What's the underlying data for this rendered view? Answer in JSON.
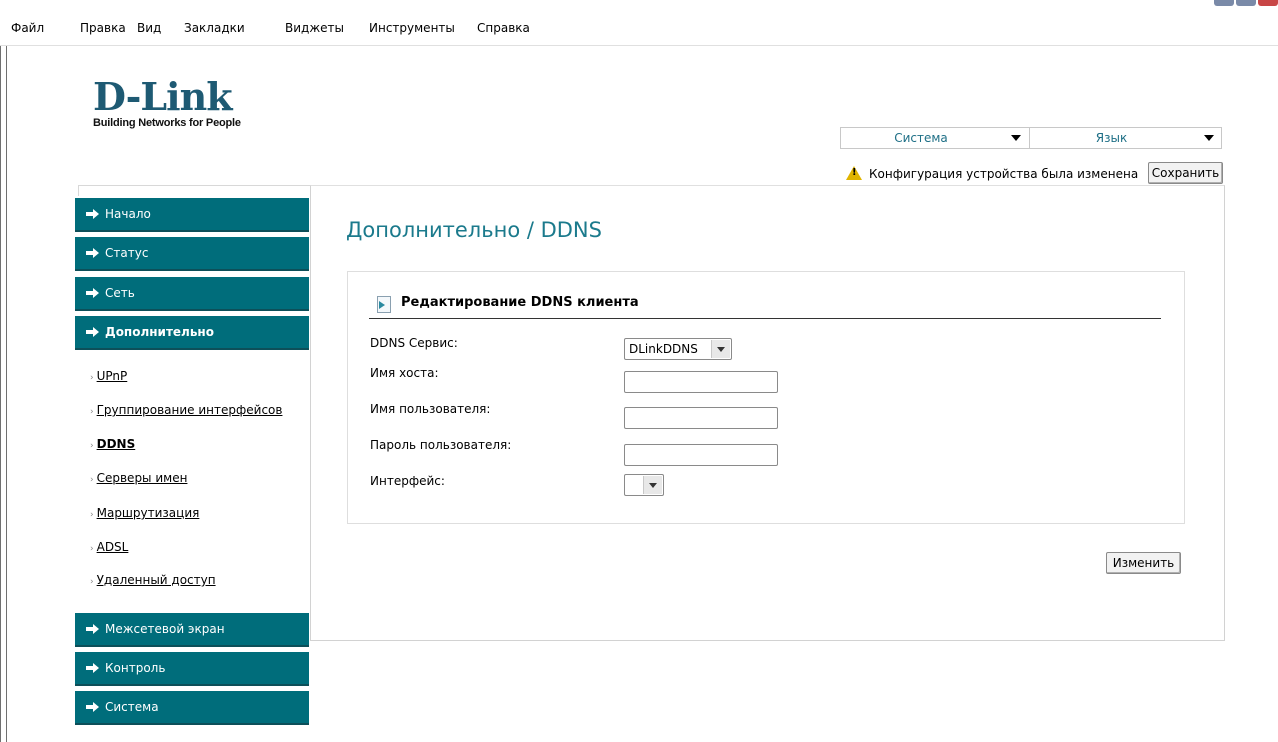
{
  "browser": {
    "menu": [
      "Файл",
      "Правка",
      "Вид",
      "Закладки",
      "Виджеты",
      "Инструменты",
      "Справка"
    ]
  },
  "header": {
    "logo_text": "D-Link",
    "logo_tagline": "Building Networks for People",
    "system_select": "Система",
    "language_select": "Язык",
    "warning_text": "Конфигурация устройства была изменена",
    "save_button": "Сохранить"
  },
  "sidebar": {
    "items": [
      {
        "label": "Начало"
      },
      {
        "label": "Статус"
      },
      {
        "label": "Сеть"
      },
      {
        "label": "Дополнительно"
      },
      {
        "label": "Межсетевой экран"
      },
      {
        "label": "Контроль"
      },
      {
        "label": "Система"
      }
    ],
    "subitems": [
      {
        "label": "UPnP"
      },
      {
        "label": "Группирование интерфейсов"
      },
      {
        "label": "DDNS"
      },
      {
        "label": "Серверы имен"
      },
      {
        "label": "Маршрутизация"
      },
      {
        "label": "ADSL"
      },
      {
        "label": "Удаленный доступ"
      }
    ]
  },
  "main": {
    "title": "Дополнительно /  DDNS",
    "section_title": "Редактирование DDNS клиента",
    "fields": {
      "ddns_service_label": "DDNS Сервис:",
      "ddns_service_value": "DLinkDDNS",
      "hostname_label": "Имя хоста:",
      "hostname_value": "",
      "username_label": "Имя пользователя:",
      "username_value": "",
      "password_label": "Пароль пользователя:",
      "password_value": "",
      "interface_label": "Интерфейс:",
      "interface_value": ""
    },
    "change_button": "Изменить"
  },
  "colors": {
    "nav_bg": "#006d7b",
    "title_color": "#1b7a8c",
    "logo_color": "#1e5a73"
  }
}
